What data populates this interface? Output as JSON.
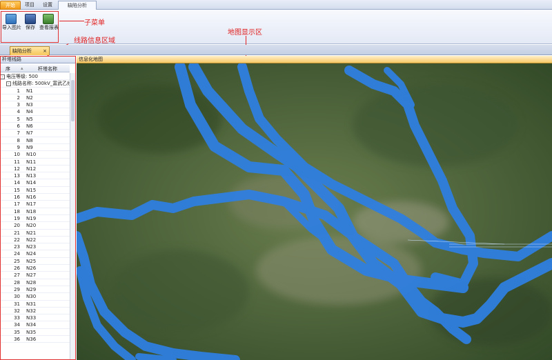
{
  "ribbon": {
    "tabs": [
      "开始",
      "项目",
      "设置",
      "缺陷分析"
    ],
    "buttons": {
      "import": "导入图片",
      "save": "保存",
      "report": "查看报表"
    }
  },
  "annotations": {
    "submenu": "子菜单",
    "map_area": "地图显示区",
    "line_info": "线路信息区域"
  },
  "doc_tab": {
    "label": "缺陷分析",
    "close": "×"
  },
  "left_panel": {
    "title": "杆塔线路",
    "col_index": "序",
    "col_name": "杆塔名称",
    "voltage": "电压等级: 500",
    "line": "线路名称: 500kV_富武乙线",
    "towers": [
      "N1",
      "N2",
      "N3",
      "N4",
      "N5",
      "N6",
      "N7",
      "N8",
      "N9",
      "N10",
      "N11",
      "N12",
      "N13",
      "N14",
      "N15",
      "N16",
      "N17",
      "N18",
      "N19",
      "N20",
      "N21",
      "N22",
      "N23",
      "N24",
      "N25",
      "N26",
      "N27",
      "N28",
      "N29",
      "N30",
      "N31",
      "N32",
      "N33",
      "N34",
      "N35",
      "N36"
    ]
  },
  "map_panel": {
    "title": "信息化地图"
  },
  "colors": {
    "accent": "#f7c867",
    "annotation": "#e02020",
    "line": "#2f7fe0",
    "terrain": "#4f6a3a"
  }
}
